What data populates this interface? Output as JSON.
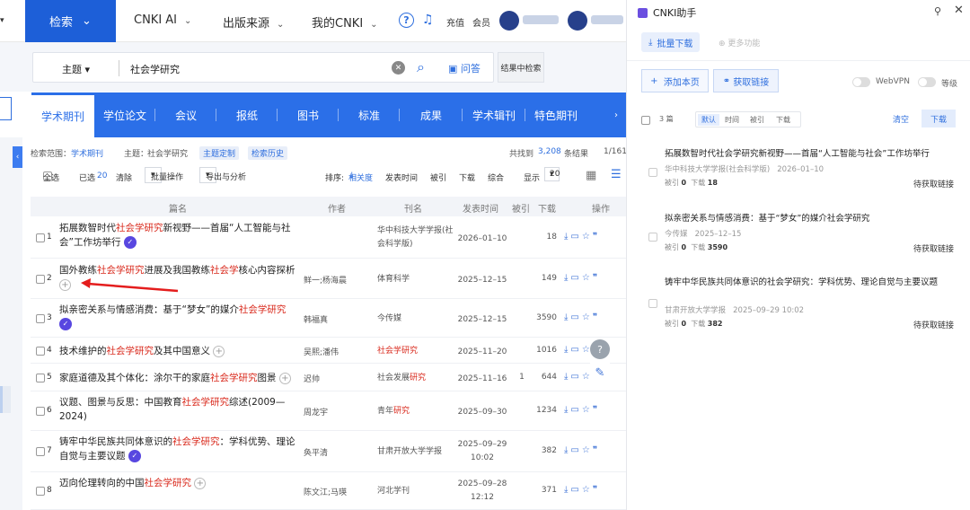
{
  "topnav": {
    "search_label": "检索",
    "items": [
      "CNKI AI",
      "出版来源",
      "我的CNKI"
    ],
    "recharge": "充值",
    "member": "会员"
  },
  "search": {
    "field": "主题",
    "query": "社会学研究",
    "ask": "问答",
    "in_results": "结果中检索"
  },
  "tabs": [
    "学术期刊",
    "学位论文",
    "会议",
    "报纸",
    "图书",
    "标准",
    "成果",
    "学术辑刊",
    "特色期刊"
  ],
  "info": {
    "scope_label": "检索范围：",
    "scope_value": "学术期刊",
    "topic_label": "主题：",
    "topic_value": "社会学研究",
    "custom": "主题定制",
    "history": "检索历史",
    "found_pre": "共找到",
    "found_count": "3,208",
    "found_post": "条结果",
    "page": "1/161"
  },
  "toolbar": {
    "select_all": "全选",
    "selected_label": "已选",
    "selected_count": "20",
    "clear": "清除",
    "batch": "批量操作",
    "export": "导出与分析",
    "sort_label": "排序:",
    "sort_active": "相关度",
    "sort_date": "发表时间",
    "sort_cite": "被引",
    "sort_download": "下载",
    "sort_overall": "综合",
    "show_label": "显示",
    "show_value": "20"
  },
  "table": {
    "headers": [
      "篇名",
      "作者",
      "刊名",
      "发表时间",
      "被引",
      "下载",
      "操作"
    ],
    "rows": [
      {
        "no": "1",
        "title_parts": [
          "拓展数智时代",
          "社会学研究",
          "新视野——首届“人工智能与社会”工作坊举行"
        ],
        "badge": "check",
        "author": "",
        "source_parts": [
          "华中科技大学学报(社会科学版)",
          ""
        ],
        "date": "2026–01–10",
        "cite": "",
        "download": "18"
      },
      {
        "no": "2",
        "title_parts": [
          "国外教练",
          "社会学研究",
          "进展及我国教练",
          "社会学",
          "核心内容探析"
        ],
        "badge": "plus",
        "author": "鲜一;杨海晨",
        "source_parts": [
          "体育科学",
          ""
        ],
        "date": "2025–12–15",
        "cite": "",
        "download": "149"
      },
      {
        "no": "3",
        "title_parts": [
          "拟亲密关系与情感消费：基于“梦女”的媒介",
          "社会学研究"
        ],
        "badge": "check",
        "author": "韩福真",
        "source_parts": [
          "今传媒",
          ""
        ],
        "date": "2025–12–15",
        "cite": "",
        "download": "3590"
      },
      {
        "no": "4",
        "title_parts": [
          "技术维护的",
          "社会学研究",
          "及其中国意义"
        ],
        "badge": "plus",
        "author": "吴熙;潘伟",
        "source_parts": [
          "",
          "社会学研究"
        ],
        "date": "2025–11–20",
        "cite": "",
        "download": "1016"
      },
      {
        "no": "5",
        "title_parts": [
          "家庭道德及其个体化：涂尔干的家庭",
          "社会学研究",
          "图景"
        ],
        "badge": "plus",
        "author": "迟帅",
        "source_parts": [
          "社会发展",
          "研究"
        ],
        "date": "2025–11–16",
        "cite": "1",
        "download": "644"
      },
      {
        "no": "6",
        "title_parts": [
          "议题、图景与反思：中国教育",
          "社会学研究",
          "综述(2009—2024)"
        ],
        "badge": "",
        "author": "周龙宇",
        "source_parts": [
          "青年",
          "研究"
        ],
        "date": "2025–09–30",
        "cite": "",
        "download": "1234"
      },
      {
        "no": "7",
        "title_parts": [
          "铸牢中华民族共同体意识的",
          "社会学研究",
          "：学科优势、理论自觉与主要议题"
        ],
        "badge": "check",
        "author": "奂平清",
        "source_parts": [
          "甘肃开放大学学报",
          ""
        ],
        "date": "2025–09–29 10:02",
        "cite": "",
        "download": "382"
      },
      {
        "no": "8",
        "title_parts": [
          "迈向伦理转向的中国",
          "社会学研究"
        ],
        "badge": "plus",
        "author": "陈文江;马瑛",
        "source_parts": [
          "河北学刊",
          ""
        ],
        "date": "2025–09–28 12:12",
        "cite": "",
        "download": "371"
      }
    ]
  },
  "panel": {
    "title": "CNKI助手",
    "bulk_download": "批量下载",
    "more": "更多功能",
    "add_page": "添加本页",
    "get_link": "获取链接",
    "webvpn": "WebVPN",
    "level": "等级",
    "count": "3 篇",
    "sorts": [
      "默认",
      "时间",
      "被引",
      "下载"
    ],
    "clear": "清空",
    "download": "下载",
    "items": [
      {
        "title": "拓展数智时代社会学研究新视野——首届“人工智能与社会”工作坊举行",
        "source": "华中科技大学学报(社会科学版)",
        "date": "2026–01–10",
        "cite": "0",
        "download": "18",
        "status": "待获取链接"
      },
      {
        "title": "拟亲密关系与情感消费：基于“梦女”的媒介社会学研究",
        "source": "今传媒",
        "date": "2025–12–15",
        "cite": "0",
        "download": "3590",
        "status": "待获取链接"
      },
      {
        "title": "铸牢中华民族共同体意识的社会学研究：学科优势、理论自觉与主要议题",
        "source": "甘肃开放大学学报",
        "date": "2025–09–29 10:02",
        "cite": "0",
        "download": "382",
        "status": "待获取链接"
      }
    ],
    "cite_label": "被引",
    "download_label": "下载"
  },
  "colors": {
    "brand": "#1d5fd8",
    "tab_bar": "#2b6fe8",
    "highlight": "#d9291c",
    "badge": "#5847e0"
  }
}
